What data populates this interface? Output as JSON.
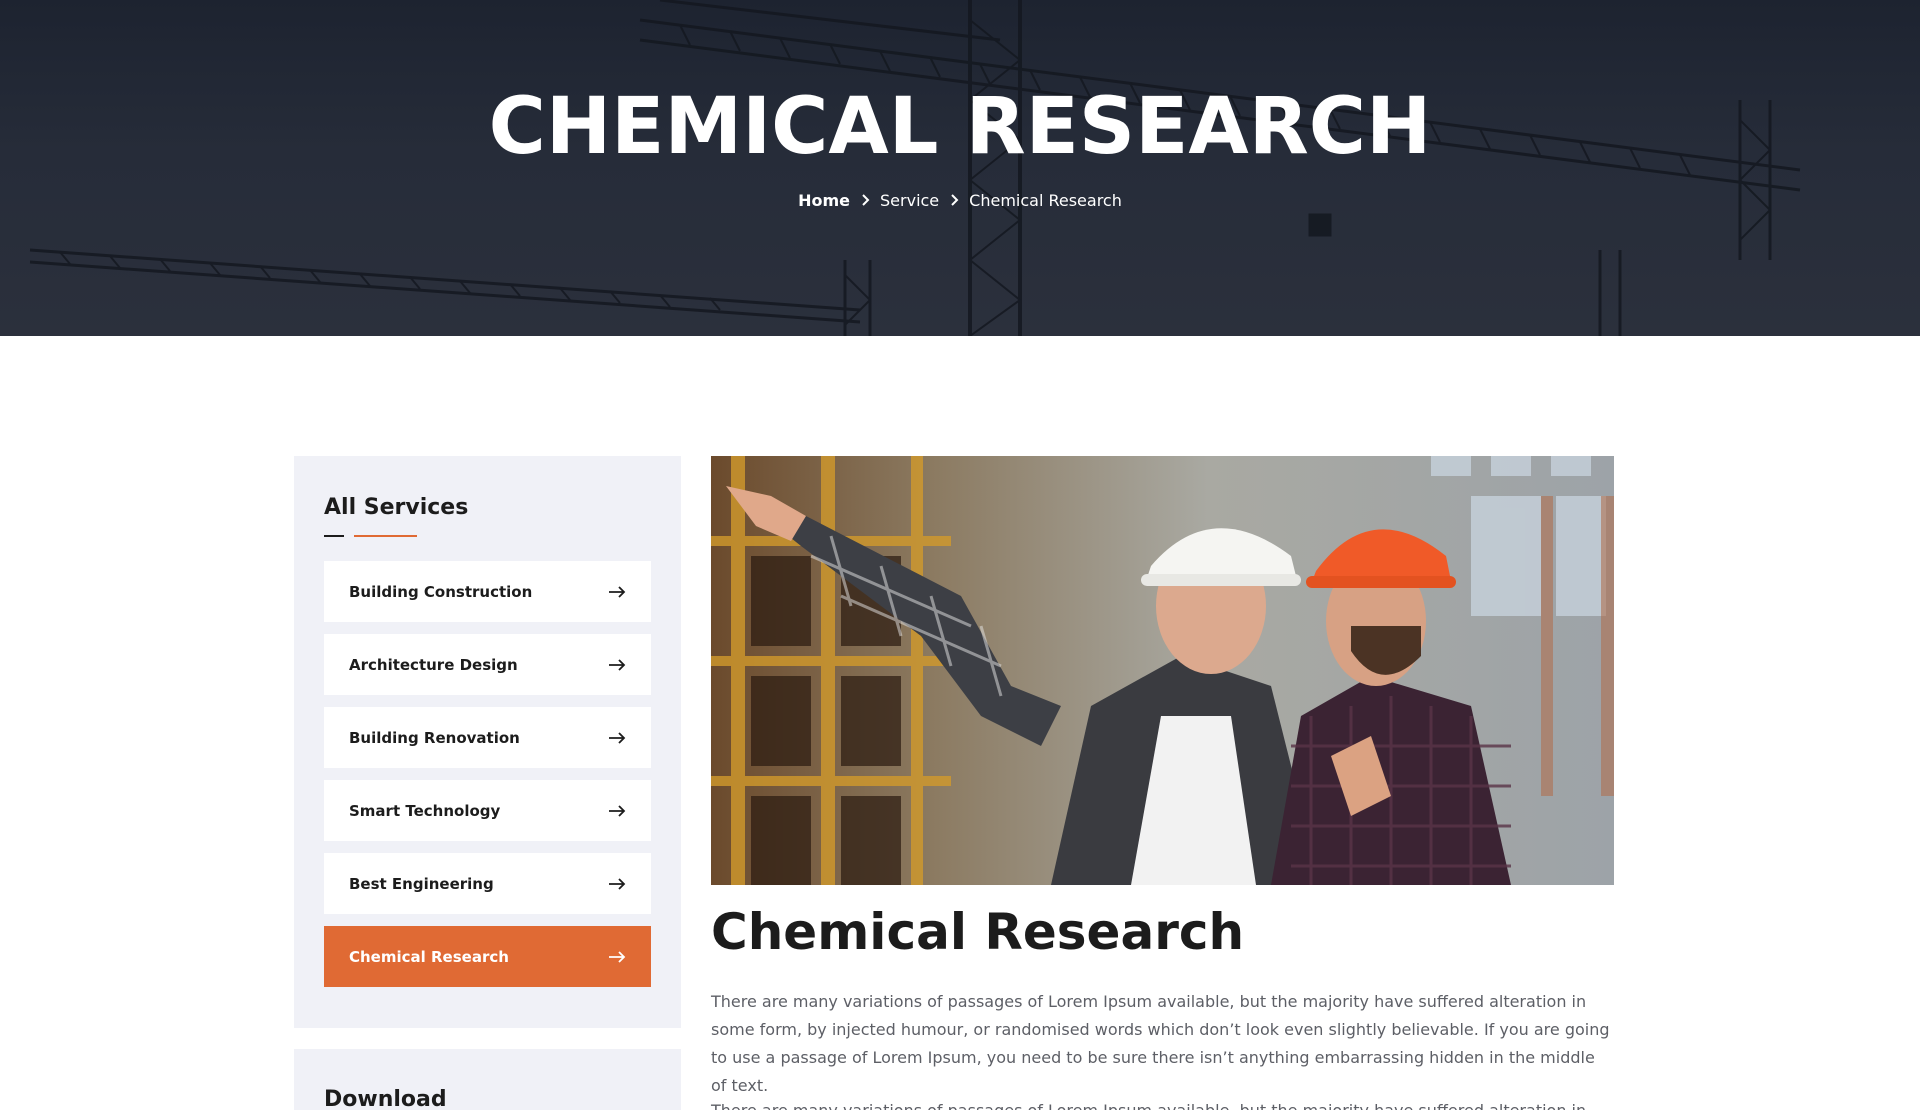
{
  "hero": {
    "title": "CHEMICAL RESEARCH",
    "breadcrumb": {
      "home": "Home",
      "service": "Service",
      "current": "Chemical Research"
    }
  },
  "sidebar": {
    "title": "All Services",
    "items": [
      {
        "label": "Building Construction",
        "icon": "arrow-right-icon"
      },
      {
        "label": "Architecture Design",
        "icon": "arrow-right-icon"
      },
      {
        "label": "Building Renovation",
        "icon": "arrow-right-icon"
      },
      {
        "label": "Smart Technology",
        "icon": "arrow-right-icon"
      },
      {
        "label": "Best Engineering",
        "icon": "arrow-right-icon"
      },
      {
        "label": "Chemical Research",
        "icon": "arrow-right-icon",
        "active": true
      }
    ],
    "download_title": "Download"
  },
  "main": {
    "heading": "Chemical Research",
    "paragraphs": [
      "There are many variations of passages of Lorem Ipsum available, but the majority have suffered alteration in some form, by injected humour, or randomised words which don’t look even slightly believable. If you are going to use a passage of Lorem Ipsum, you need to be sure there isn’t anything embarrassing hidden in the middle of text.",
      "There are many variations of passages of Lorem Ipsum available, but the majority have suffered alteration in some form,"
    ]
  },
  "colors": {
    "accent": "#e06a34",
    "hero_bg": "#242a36",
    "sidebar_bg": "#f0f1f7",
    "body_text": "#5d5f66"
  }
}
